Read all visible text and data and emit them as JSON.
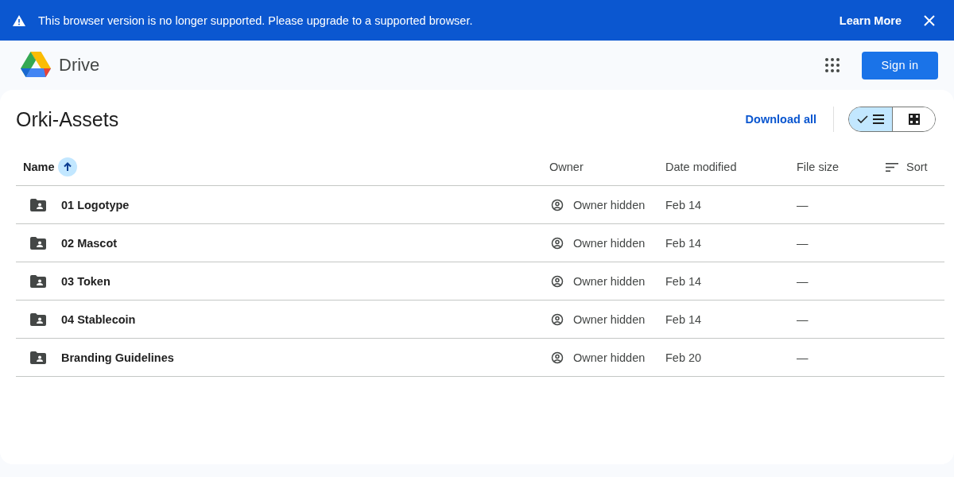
{
  "banner": {
    "message": "This browser version is no longer supported. Please upgrade to a supported browser.",
    "link": "Learn More"
  },
  "header": {
    "app_name": "Drive",
    "sign_in": "Sign in"
  },
  "folder": {
    "title": "Orki-Assets",
    "download_all": "Download all",
    "view_options": [
      {
        "kind": "list",
        "selected": true
      },
      {
        "kind": "grid",
        "selected": false
      }
    ]
  },
  "table": {
    "columns": [
      {
        "label": "Name",
        "sorted": true
      },
      {
        "label": "Owner",
        "sorted": false
      },
      {
        "label": "Date modified",
        "sorted": false
      },
      {
        "label": "File size",
        "sorted": false
      }
    ],
    "sort_label": "Sort",
    "rows": [
      {
        "name": "01 Logotype",
        "owner": "Owner hidden",
        "date": "Feb 14",
        "size": "—"
      },
      {
        "name": "02 Mascot",
        "owner": "Owner hidden",
        "date": "Feb 14",
        "size": "—"
      },
      {
        "name": "03 Token",
        "owner": "Owner hidden",
        "date": "Feb 14",
        "size": "—"
      },
      {
        "name": "04 Stablecoin",
        "owner": "Owner hidden",
        "date": "Feb 14",
        "size": "—"
      },
      {
        "name": "Branding Guidelines",
        "owner": "Owner hidden",
        "date": "Feb 20",
        "size": "—"
      }
    ]
  }
}
